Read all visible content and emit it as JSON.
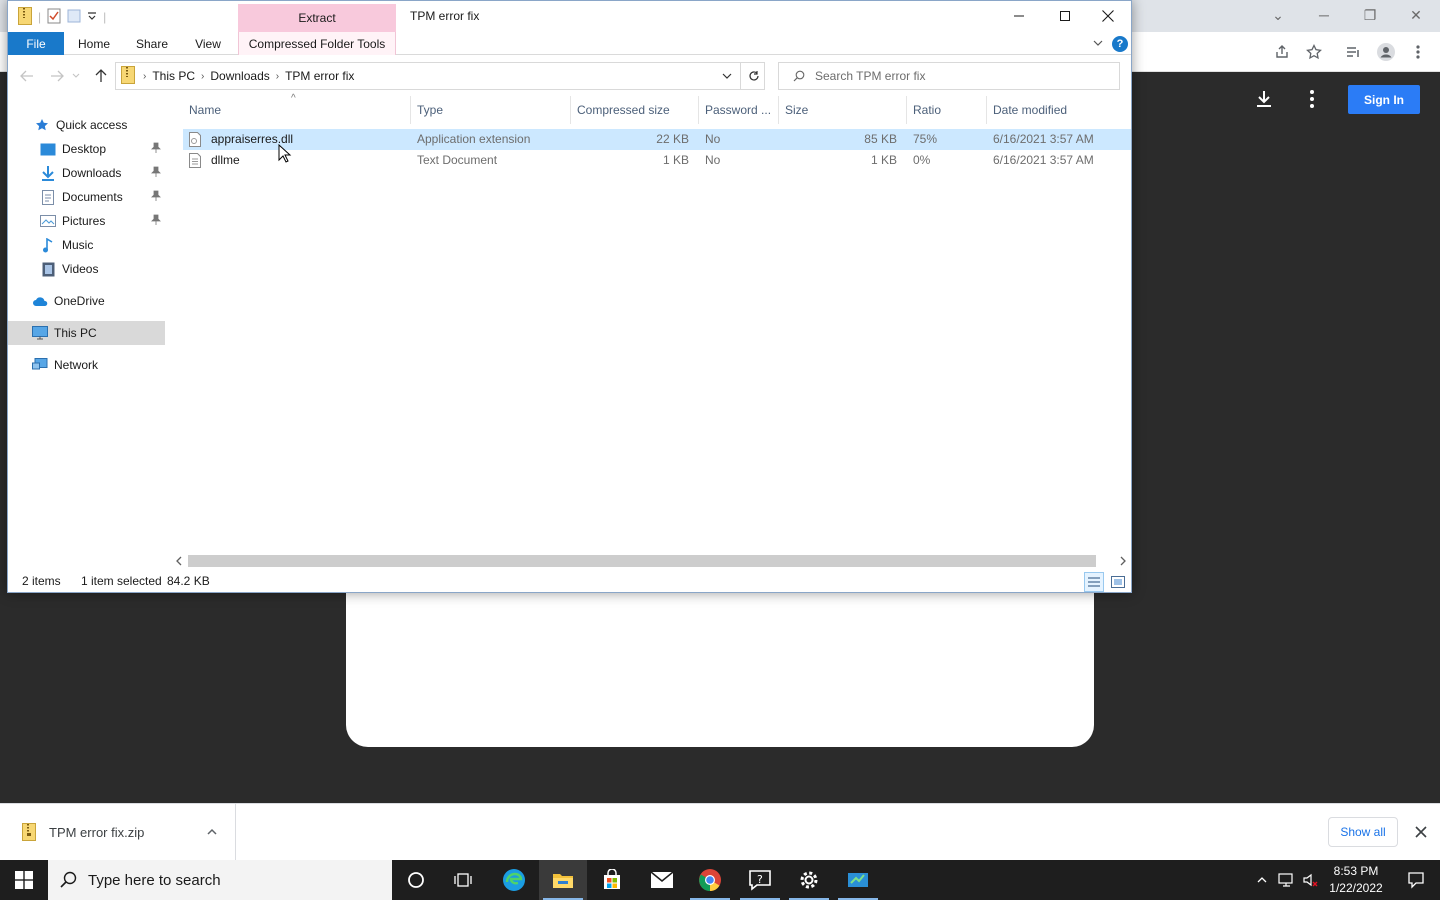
{
  "explorer": {
    "title": "TPM error fix",
    "context_tab": "Extract",
    "ribbon_tabs": [
      "File",
      "Home",
      "Share",
      "View",
      "Compressed Folder Tools"
    ],
    "address": {
      "crumbs": [
        "This PC",
        "Downloads",
        "TPM error fix"
      ]
    },
    "search_placeholder": "Search TPM error fix",
    "nav_pane": {
      "quick_access": "Quick access",
      "items": [
        "Desktop",
        "Downloads",
        "Documents",
        "Pictures",
        "Music",
        "Videos"
      ],
      "onedrive": "OneDrive",
      "this_pc": "This PC",
      "network": "Network"
    },
    "columns": [
      "Name",
      "Type",
      "Compressed size",
      "Password ...",
      "Size",
      "Ratio",
      "Date modified"
    ],
    "files": [
      {
        "name": "appraiserres.dll",
        "type": "Application extension",
        "compressed": "22 KB",
        "password": "No",
        "size": "85 KB",
        "ratio": "75%",
        "date": "6/16/2021 3:57 AM"
      },
      {
        "name": "dllme",
        "type": "Text Document",
        "compressed": "1 KB",
        "password": "No",
        "size": "1 KB",
        "ratio": "0%",
        "date": "6/16/2021 3:57 AM"
      }
    ],
    "status": {
      "items": "2 items",
      "selected": "1 item selected",
      "size": "84.2 KB"
    }
  },
  "browser": {
    "signin": "Sign In",
    "download_shelf": {
      "file": "TPM error fix.zip",
      "show_all": "Show all"
    }
  },
  "taskbar": {
    "search_placeholder": "Type here to search",
    "time": "8:53 PM",
    "date": "1/22/2022"
  },
  "colors": {
    "accent_blue": "#1979ca",
    "extract_pink": "#f8c9dc",
    "selection": "#cce8ff",
    "signin_blue": "#2b7cf6"
  }
}
